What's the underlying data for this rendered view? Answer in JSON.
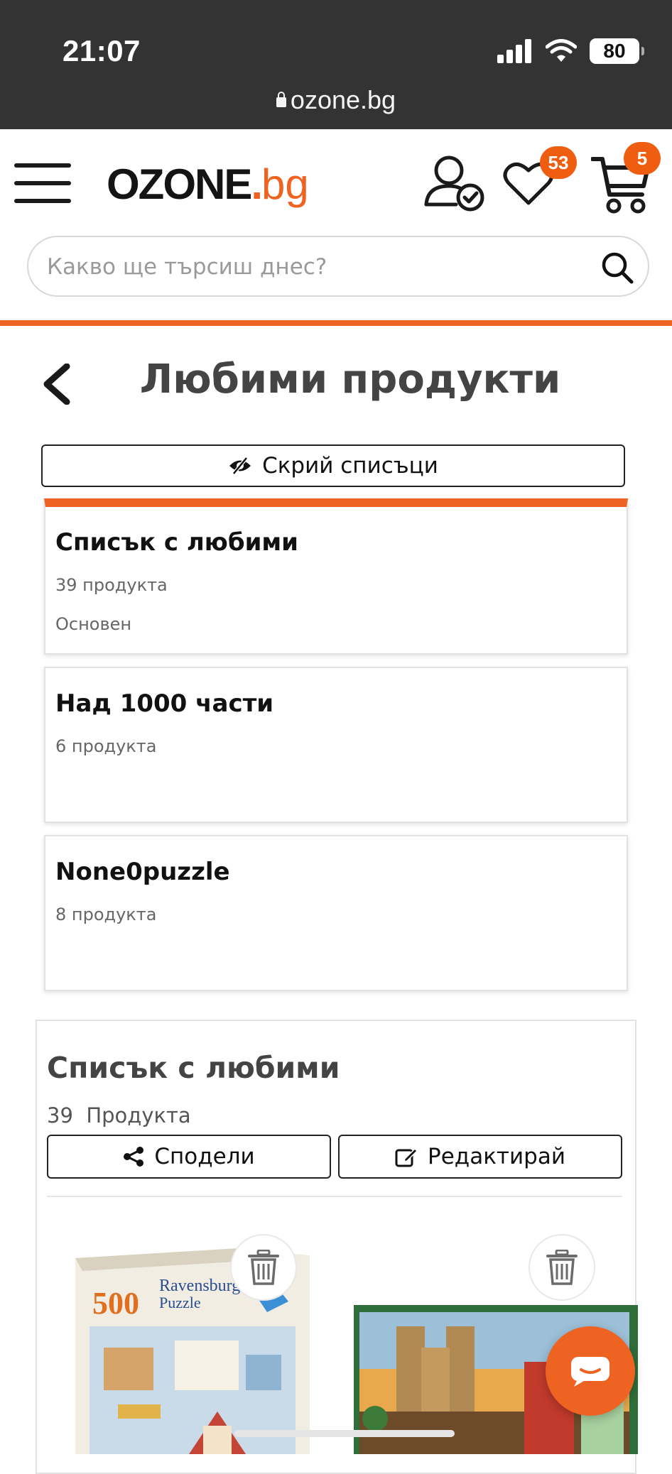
{
  "status_bar": {
    "time": "21:07",
    "battery": "80",
    "url": "ozone.bg"
  },
  "header": {
    "logo_main": "OZONE",
    "logo_dot": ".",
    "logo_suffix": "bg",
    "wishlist_badge": "53",
    "cart_badge": "5",
    "accent_color": "#ef6322"
  },
  "search": {
    "placeholder": "Какво ще търсиш днес?"
  },
  "page": {
    "title": "Любими продукти",
    "hide_lists_label": "Скрий списъци"
  },
  "lists": [
    {
      "title": "Списък с любими",
      "count": "39 продукта",
      "note": "Основен"
    },
    {
      "title": "Над 1000 части",
      "count": "6 продукта",
      "note": ""
    },
    {
      "title": "None0puzzle",
      "count": "8 продукта",
      "note": ""
    }
  ],
  "selected_list": {
    "title": "Списък с любими",
    "count_number": "39",
    "count_label": "Продукта",
    "share_label": "Сподели",
    "edit_label": "Редактирай"
  },
  "products": [
    {
      "box_number": "500",
      "box_brand": "Ravensburger",
      "box_type": "Puzzle"
    },
    {
      "box_number": "",
      "box_brand": "",
      "box_type": ""
    }
  ]
}
